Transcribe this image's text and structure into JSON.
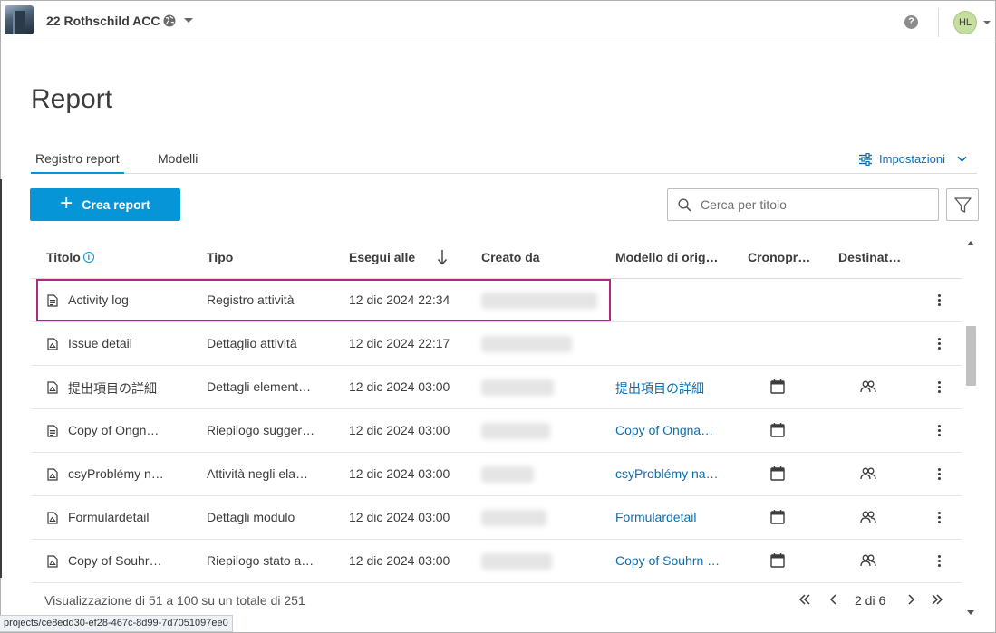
{
  "header": {
    "project_name": "22 Rothschild ACC",
    "help_glyph": "?",
    "avatar_initials": "HL"
  },
  "page": {
    "title": "Report"
  },
  "tabs": [
    {
      "label": "Registro report",
      "active": true
    },
    {
      "label": "Modelli",
      "active": false
    }
  ],
  "settings": {
    "label": "Impostazioni"
  },
  "toolbar": {
    "create_label": "Crea report",
    "search_placeholder": "Cerca per titolo"
  },
  "table": {
    "columns": [
      "Titolo",
      "Tipo",
      "Esegui alle",
      "Creato da",
      "Modello di orig…",
      "Cronopr…",
      "Destinat…"
    ],
    "rows": [
      {
        "title": "Activity log",
        "type": "Registro attività",
        "run_at": "12 dic 2024 22:34",
        "source_template": "",
        "schedule": false,
        "recipients": false
      },
      {
        "title": "Issue detail",
        "type": "Dettaglio attività",
        "run_at": "12 dic 2024 22:17",
        "source_template": "",
        "schedule": false,
        "recipients": false
      },
      {
        "title": "提出項目の詳細",
        "type": "Dettagli element…",
        "run_at": "12 dic 2024 03:00",
        "source_template": "提出項目の詳細",
        "schedule": true,
        "recipients": true
      },
      {
        "title": "Copy of Ongn…",
        "type": "Riepilogo sugger…",
        "run_at": "12 dic 2024 03:00",
        "source_template": "Copy of Ongna…",
        "schedule": true,
        "recipients": false
      },
      {
        "title": "csyProblémy n…",
        "type": "Attività negli ela…",
        "run_at": "12 dic 2024 03:00",
        "source_template": "csyProblémy na…",
        "schedule": true,
        "recipients": true
      },
      {
        "title": "Formulardetail",
        "type": "Dettagli modulo",
        "run_at": "12 dic 2024 03:00",
        "source_template": "Formulardetail",
        "schedule": true,
        "recipients": true
      },
      {
        "title": "Copy of Souhr…",
        "type": "Riepilogo stato a…",
        "run_at": "12 dic 2024 03:00",
        "source_template": "Copy of Souhrn …",
        "schedule": true,
        "recipients": true
      }
    ]
  },
  "footer": {
    "summary": "Visualizzazione di 51 a 100 su un totale di 251",
    "page_info": "2 di 6"
  },
  "status_bar": {
    "url": "projects/ce8edd30-ef28-467c-8d99-7d7051097ee0"
  },
  "colors": {
    "accent": "#0696d7",
    "link": "#0a6fb3",
    "highlight_border": "#b3287c"
  }
}
